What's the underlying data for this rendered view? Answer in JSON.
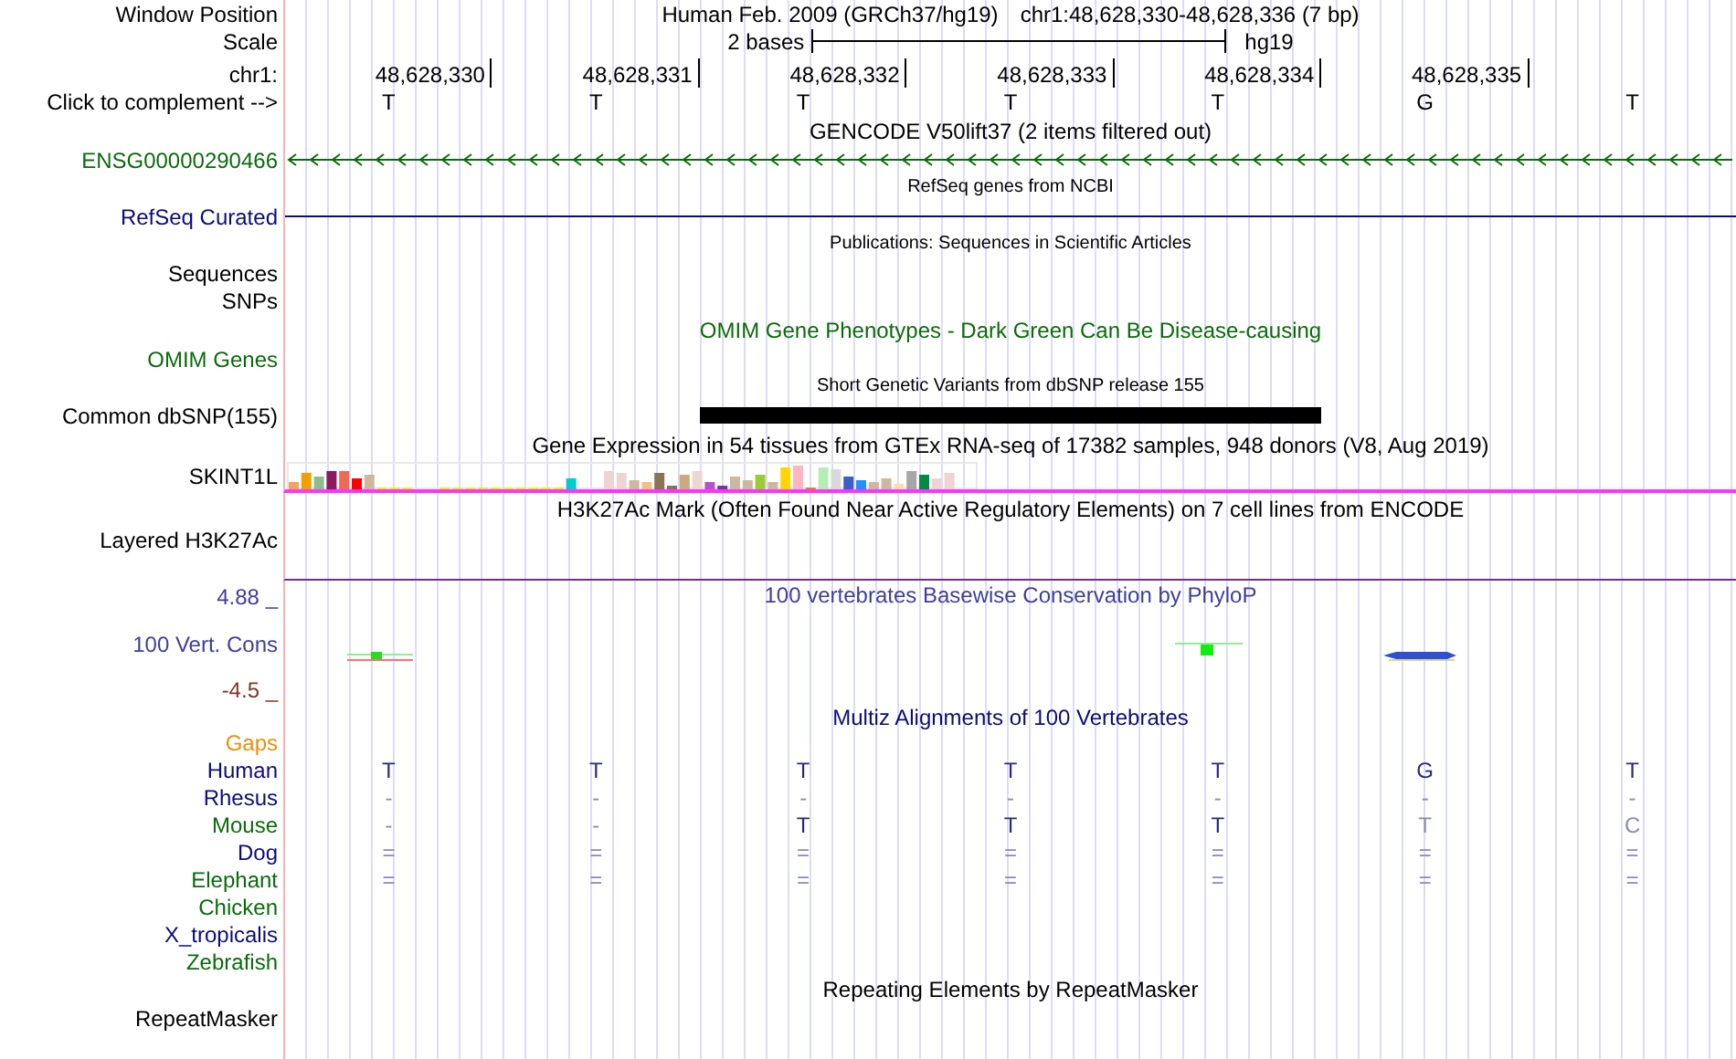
{
  "header": {
    "label": "Window Position",
    "assembly": "Human Feb. 2009 (GRCh37/hg19)",
    "range": "chr1:48,628,330-48,628,336 (7 bp)"
  },
  "scale": {
    "label": "Scale",
    "length": "2 bases",
    "assembly": "hg19"
  },
  "ruler": {
    "label": "chr1:",
    "positions": [
      "48,628,330",
      "48,628,331",
      "48,628,332",
      "48,628,333",
      "48,628,334",
      "48,628,335"
    ]
  },
  "sequence": {
    "label": "Click to complement -->",
    "bases": [
      "T",
      "T",
      "T",
      "T",
      "T",
      "G",
      "T"
    ]
  },
  "tracks": [
    {
      "kind": "gene",
      "title": {
        "text": "GENCODE V50lift37 (2 items filtered out)",
        "color": "#000000"
      },
      "label": "ENSG00000290466",
      "color": "#0b6b0b"
    },
    {
      "kind": "line",
      "title": {
        "text": "RefSeq genes from NCBI",
        "color": "#000000"
      },
      "label": "RefSeq Curated",
      "color": "#0c0c78"
    },
    {
      "kind": "list",
      "title": {
        "text": "Publications: Sequences in Scientific Articles",
        "color": "#000000"
      },
      "labels": [
        "Sequences",
        "SNPs"
      ],
      "color": "#000000"
    },
    {
      "kind": "empty",
      "title": {
        "text": "OMIM Gene Phenotypes - Dark Green Can Be Disease-causing",
        "color": "#0b6b0b"
      },
      "label": "OMIM Genes",
      "color": "#0b6b0b"
    },
    {
      "kind": "variants",
      "title": {
        "text": "Short Genetic Variants from dbSNP release 155",
        "color": "#000000"
      },
      "label": "Common dbSNP(155)",
      "color": "#000000",
      "covered": [
        false,
        false,
        true,
        true,
        true,
        false,
        false
      ]
    },
    {
      "kind": "expression",
      "title": {
        "text": "Gene Expression in 54 tissues from GTEx RNA-seq of 17382 samples, 948 donors (V8, Aug 2019)",
        "color": "#000000"
      },
      "label": "SKINT1L",
      "color": "#000000"
    },
    {
      "kind": "signal",
      "title": {
        "text": "H3K27Ac Mark (Often Found Near Active Regulatory Elements) on 7 cell lines from ENCODE",
        "color": "#000000"
      },
      "label": "Layered H3K27Ac",
      "color": "#000000"
    },
    {
      "kind": "conservation",
      "title": {
        "text": "100 vertebrates Basewise Conservation by PhyloP",
        "color": "#3f3f9a"
      },
      "label": "100 Vert. Cons",
      "color": "#3f3f9a",
      "max": "4.88 _",
      "min": "-4.5 _"
    },
    {
      "kind": "alignment",
      "title": {
        "text": "Multiz Alignments of 100 Vertebrates",
        "color": "#0c0c78"
      },
      "gaps": {
        "label": "Gaps",
        "color": "#e8900a"
      },
      "species": [
        {
          "name": "Human",
          "color": "#0c0c78",
          "cells": [
            {
              "text": "T",
              "faint": false
            },
            {
              "text": "T",
              "faint": false
            },
            {
              "text": "T",
              "faint": false
            },
            {
              "text": "T",
              "faint": false
            },
            {
              "text": "T",
              "faint": false
            },
            {
              "text": "G",
              "faint": false
            },
            {
              "text": "T",
              "faint": false
            }
          ]
        },
        {
          "name": "Rhesus",
          "color": "#0c0c78",
          "cells": [
            {
              "text": "-",
              "faint": true
            },
            {
              "text": "-",
              "faint": true
            },
            {
              "text": "-",
              "faint": true
            },
            {
              "text": "-",
              "faint": true
            },
            {
              "text": "-",
              "faint": true
            },
            {
              "text": "-",
              "faint": true
            },
            {
              "text": "-",
              "faint": true
            }
          ]
        },
        {
          "name": "Mouse",
          "color": "#0b6b0b",
          "cells": [
            {
              "text": "-",
              "faint": true
            },
            {
              "text": "-",
              "faint": true
            },
            {
              "text": "T",
              "faint": false
            },
            {
              "text": "T",
              "faint": false
            },
            {
              "text": "T",
              "faint": false
            },
            {
              "text": "T",
              "faint": true
            },
            {
              "text": "C",
              "faint": true
            }
          ]
        },
        {
          "name": "Dog",
          "color": "#0c0c78",
          "cells": [
            {
              "text": "=",
              "faint": true
            },
            {
              "text": "=",
              "faint": true
            },
            {
              "text": "=",
              "faint": true
            },
            {
              "text": "=",
              "faint": true
            },
            {
              "text": "=",
              "faint": true
            },
            {
              "text": "=",
              "faint": true
            },
            {
              "text": "=",
              "faint": true
            }
          ]
        },
        {
          "name": "Elephant",
          "color": "#0b6b0b",
          "cells": [
            {
              "text": "=",
              "faint": true
            },
            {
              "text": "=",
              "faint": true
            },
            {
              "text": "=",
              "faint": true
            },
            {
              "text": "=",
              "faint": true
            },
            {
              "text": "=",
              "faint": true
            },
            {
              "text": "=",
              "faint": true
            },
            {
              "text": "=",
              "faint": true
            }
          ]
        },
        {
          "name": "Chicken",
          "color": "#0b6b0b"
        },
        {
          "name": "X_tropicalis",
          "color": "#0c0c78"
        },
        {
          "name": "Zebrafish",
          "color": "#0b6b0b"
        }
      ]
    },
    {
      "kind": "empty",
      "title": {
        "text": "Repeating Elements by RepeatMasker",
        "color": "#000000"
      },
      "label": "RepeatMasker",
      "color": "#000000"
    }
  ]
}
